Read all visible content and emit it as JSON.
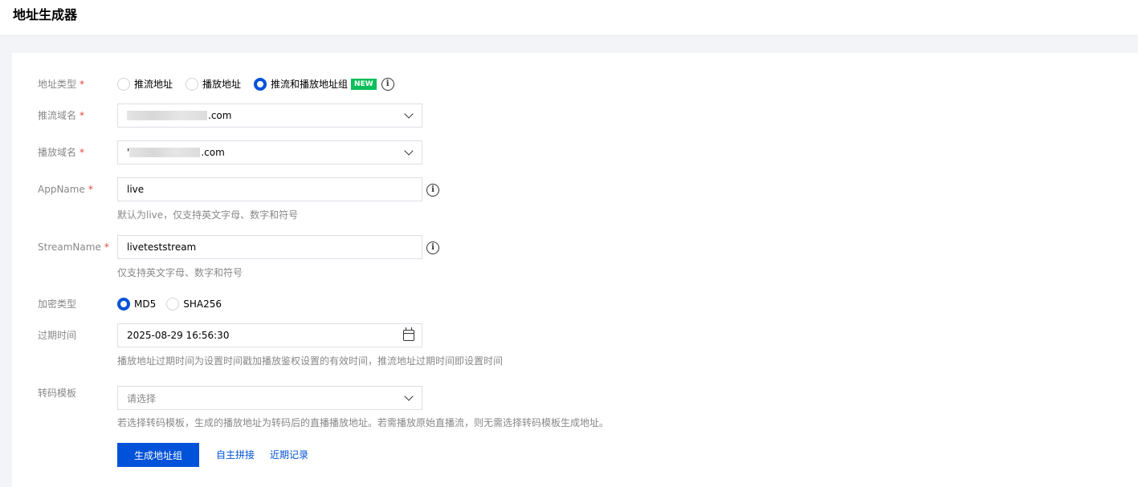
{
  "page": {
    "title": "地址生成器"
  },
  "form": {
    "addr_type": {
      "label": "地址类型",
      "required": "*",
      "options": [
        "推流地址",
        "播放地址",
        "推流和播放地址组"
      ],
      "selected": "推流和播放地址组",
      "badge": "NEW"
    },
    "push_domain": {
      "label": "推流域名",
      "required": "*",
      "value_suffix": ".com"
    },
    "play_domain": {
      "label": "播放域名",
      "required": "*",
      "value_prefix": "'",
      "value_suffix": ".com"
    },
    "app_name": {
      "label": "AppName",
      "required": "*",
      "value": "live",
      "hint": "默认为live，仅支持英文字母、数字和符号"
    },
    "stream_name": {
      "label": "StreamName",
      "required": "*",
      "value": "liveteststream",
      "hint": "仅支持英文字母、数字和符号"
    },
    "encrypt_type": {
      "label": "加密类型",
      "options": [
        "MD5",
        "SHA256"
      ],
      "selected": "MD5"
    },
    "expire_time": {
      "label": "过期时间",
      "value": "2025-08-29 16:56:30",
      "hint": "播放地址过期时间为设置时间戳加播放鉴权设置的有效时间，推流地址过期时间即设置时间"
    },
    "transcode": {
      "label": "转码模板",
      "placeholder": "请选择",
      "hint": "若选择转码模板，生成的播放地址为转码后的直播播放地址。若需播放原始直播流，则无需选择转码模板生成地址。"
    }
  },
  "actions": {
    "generate": "生成地址组",
    "custom_concat": "自主拼接",
    "recent_records": "近期记录"
  },
  "icons": {
    "info": "info-circle-icon",
    "chevron": "chevron-down-icon",
    "calendar": "calendar-icon"
  },
  "colors": {
    "primary": "#0052d9",
    "required": "#e54545",
    "badge": "#0abf5b"
  }
}
